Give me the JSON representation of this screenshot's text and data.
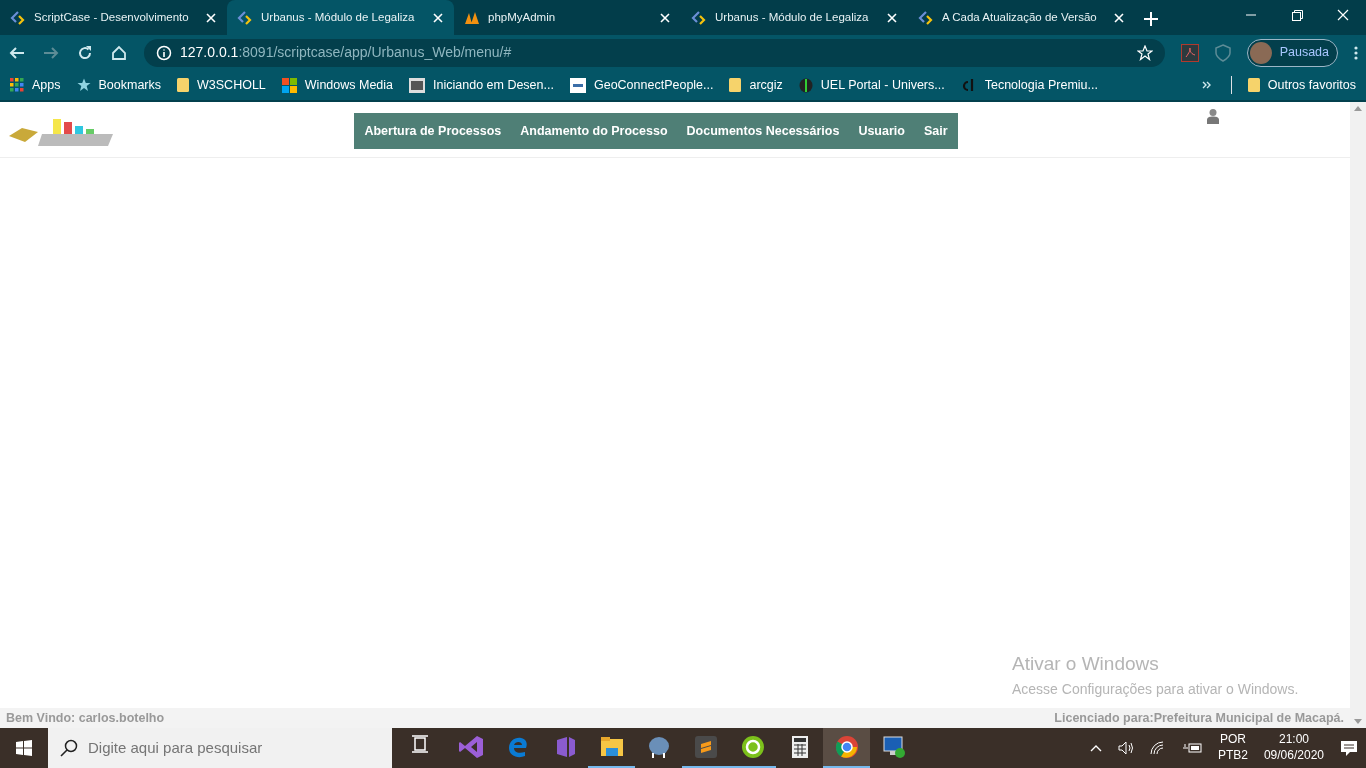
{
  "browser": {
    "tabs": [
      {
        "title": "ScriptCase - Desenvolvimento",
        "kind": "scriptcase",
        "selected": false
      },
      {
        "title": "Urbanus - Módulo de Legaliza",
        "kind": "scriptcase",
        "selected": true
      },
      {
        "title": "phpMyAdmin",
        "kind": "sail",
        "selected": false
      },
      {
        "title": "Urbanus - Módulo de Legaliza",
        "kind": "scriptcase",
        "selected": false
      },
      {
        "title": "A Cada Atualização de Versão",
        "kind": "scriptcase",
        "selected": false
      }
    ],
    "address": {
      "host": "127.0.0.1",
      "path": ":8091/scriptcase/app/Urbanus_Web/menu/#"
    },
    "profile": {
      "label": "Pausada"
    },
    "bookmarks": [
      {
        "label": "Apps",
        "kind": "apps"
      },
      {
        "label": "Bookmarks",
        "kind": "star"
      },
      {
        "label": "W3SCHOLL",
        "kind": "folder"
      },
      {
        "label": "Windows Media",
        "kind": "windows"
      },
      {
        "label": "Iniciando em Desen...",
        "kind": "picture"
      },
      {
        "label": "GeoConnectPeople...",
        "kind": "doc"
      },
      {
        "label": "arcgiz",
        "kind": "folder"
      },
      {
        "label": "UEL Portal - Univers...",
        "kind": "globe"
      },
      {
        "label": "Tecnologia Premiu...",
        "kind": "mark"
      }
    ],
    "other_bookmarks": {
      "label": "Outros favoritos"
    }
  },
  "page": {
    "menu": [
      {
        "label": "Abertura de Processos"
      },
      {
        "label": "Andamento do Processo"
      },
      {
        "label": "Documentos Necessários"
      },
      {
        "label": "Usuario"
      },
      {
        "label": "Sair"
      }
    ],
    "footer_left": "Bem Vindo: carlos.botelho",
    "footer_right": "Licenciado para:Prefeitura Municipal de Macapá."
  },
  "activation": {
    "title": "Ativar o Windows",
    "text": "Acesse Configurações para ativar o Windows."
  },
  "taskbar": {
    "search": {
      "placeholder": "Digite aqui para pesquisar"
    },
    "apps": [
      {
        "kind": "taskview",
        "running": false,
        "selected": false
      },
      {
        "kind": "vs",
        "running": false,
        "selected": false
      },
      {
        "kind": "edge",
        "running": false,
        "selected": false
      },
      {
        "kind": "vs2",
        "running": false,
        "selected": false
      },
      {
        "kind": "explorer",
        "running": true,
        "selected": false
      },
      {
        "kind": "elephant",
        "running": false,
        "selected": false
      },
      {
        "kind": "sublime",
        "running": true,
        "selected": false
      },
      {
        "kind": "dreamweaver",
        "running": true,
        "selected": false
      },
      {
        "kind": "calculator",
        "running": false,
        "selected": false
      },
      {
        "kind": "chrome",
        "running": true,
        "selected": true
      },
      {
        "kind": "remote",
        "running": false,
        "selected": false
      }
    ],
    "language": [
      "POR",
      "PTB2"
    ],
    "time": "21:00",
    "date": "09/06/2020"
  }
}
